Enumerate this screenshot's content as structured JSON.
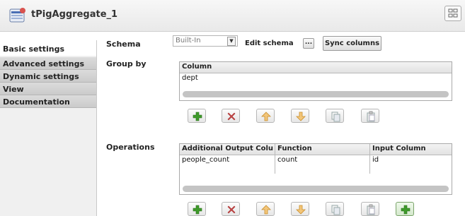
{
  "component": {
    "title": "tPigAggregate_1",
    "icon": "pig-aggregate-component-icon"
  },
  "sidebar": {
    "items": [
      {
        "label": "Basic settings",
        "active": true
      },
      {
        "label": "Advanced settings"
      },
      {
        "label": "Dynamic settings"
      },
      {
        "label": "View"
      },
      {
        "label": "Documentation"
      }
    ]
  },
  "schema": {
    "label": "Schema",
    "mode_value": "Built-In",
    "edit_label": "Edit schema",
    "edit_button": "...",
    "sync_button": "Sync columns"
  },
  "group_by": {
    "label": "Group by",
    "columns": [
      "Column"
    ],
    "rows": [
      [
        "dept"
      ]
    ]
  },
  "operations": {
    "label": "Operations",
    "columns": [
      "Additional Output Colu",
      "Function",
      "Input Column"
    ],
    "rows": [
      [
        "people_count",
        "count",
        "id"
      ]
    ]
  },
  "toolbar_icons": [
    "add-icon",
    "remove-icon",
    "move-up-icon",
    "move-down-icon",
    "copy-icon",
    "paste-icon"
  ],
  "colors": {
    "add": "#3e9a2a",
    "remove": "#c64a4a",
    "arrows": "#e0a43a"
  }
}
